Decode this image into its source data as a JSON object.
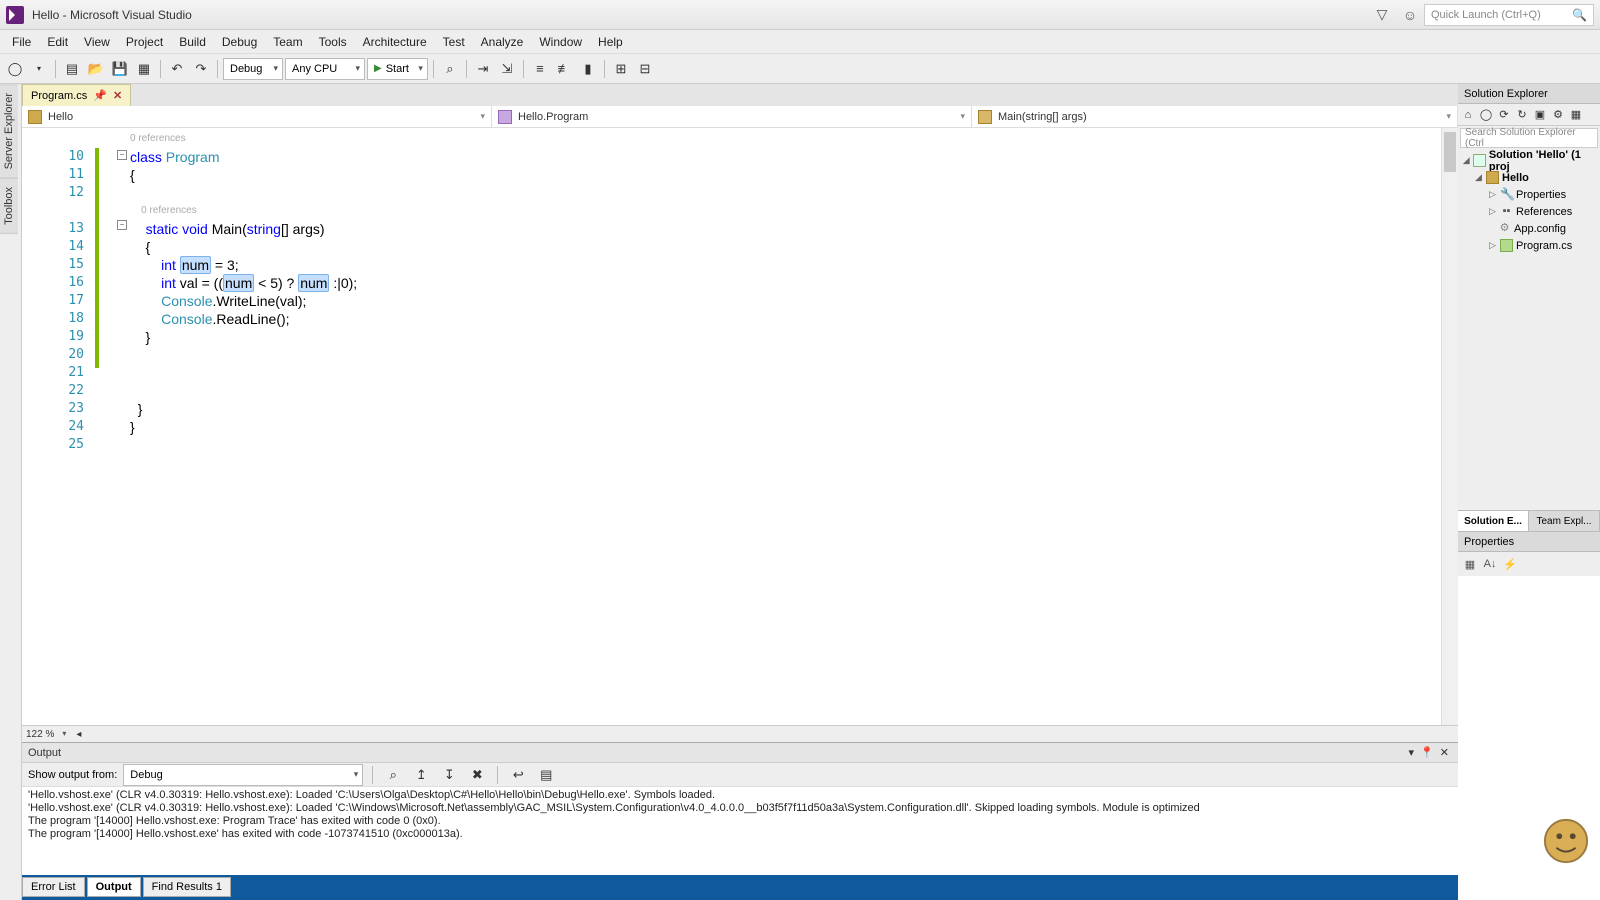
{
  "title": "Hello - Microsoft Visual Studio",
  "quick_launch_placeholder": "Quick Launch (Ctrl+Q)",
  "menu": [
    "File",
    "Edit",
    "View",
    "Project",
    "Build",
    "Debug",
    "Team",
    "Tools",
    "Architecture",
    "Test",
    "Analyze",
    "Window",
    "Help"
  ],
  "toolbar": {
    "config": "Debug",
    "platform": "Any CPU",
    "start": "Start"
  },
  "left_rail": [
    "Server Explorer",
    "Toolbox"
  ],
  "doc_tab": {
    "label": "Program.cs"
  },
  "context": {
    "project": "Hello",
    "class": "Hello.Program",
    "member": "Main(string[] args)"
  },
  "editor": {
    "first_line": 10,
    "reference_hint": "0 references",
    "code_lines": [
      {
        "n": 10,
        "html": "<span class='kw'>class</span> <span class='typ'>Program</span>"
      },
      {
        "n": 11,
        "html": "{"
      },
      {
        "n": 12,
        "html": ""
      },
      {
        "n": 13,
        "html": "    <span class='kw'>static</span> <span class='kw'>void</span> Main(<span class='kw'>string</span>[] args)"
      },
      {
        "n": 14,
        "html": "    {"
      },
      {
        "n": 15,
        "html": "        <span class='kw'>int</span> <span class='highlight-num'>num</span> = 3;"
      },
      {
        "n": 16,
        "html": "        <span class='kw'>int</span> val = ((<span class='highlight-num'>num</span> &lt; 5) ? <span class='highlight-num'>num</span> :|0);"
      },
      {
        "n": 17,
        "html": "        <span class='typ'>Console</span>.WriteLine(val);"
      },
      {
        "n": 18,
        "html": "        <span class='typ'>Console</span>.ReadLine();"
      },
      {
        "n": 19,
        "html": "    }"
      },
      {
        "n": 20,
        "html": ""
      },
      {
        "n": 21,
        "html": ""
      },
      {
        "n": 22,
        "html": ""
      },
      {
        "n": 23,
        "html": "  }"
      },
      {
        "n": 24,
        "html": "}"
      },
      {
        "n": 25,
        "html": ""
      }
    ]
  },
  "zoom": "122 %",
  "output": {
    "title": "Output",
    "show_from_label": "Show output from:",
    "show_from_value": "Debug",
    "lines": [
      "'Hello.vshost.exe' (CLR v4.0.30319: Hello.vshost.exe): Loaded 'C:\\Users\\Olga\\Desktop\\C#\\Hello\\Hello\\bin\\Debug\\Hello.exe'. Symbols loaded.",
      "'Hello.vshost.exe' (CLR v4.0.30319: Hello.vshost.exe): Loaded 'C:\\Windows\\Microsoft.Net\\assembly\\GAC_MSIL\\System.Configuration\\v4.0_4.0.0.0__b03f5f7f11d50a3a\\System.Configuration.dll'. Skipped loading symbols. Module is optimized",
      "The program '[14000] Hello.vshost.exe: Program Trace' has exited with code 0 (0x0).",
      "The program '[14000] Hello.vshost.exe' has exited with code -1073741510 (0xc000013a)."
    ]
  },
  "bottom_tabs": [
    "Error List",
    "Output",
    "Find Results 1"
  ],
  "bottom_active": 1,
  "right": {
    "solution_panel_title": "Solution Explorer",
    "search_placeholder": "Search Solution Explorer (Ctrl",
    "solution_label": "Solution 'Hello' (1 proj",
    "project": "Hello",
    "nodes": [
      "Properties",
      "References",
      "App.config",
      "Program.cs"
    ],
    "tabs": [
      "Solution E...",
      "Team Expl..."
    ],
    "prop_title": "Properties"
  }
}
